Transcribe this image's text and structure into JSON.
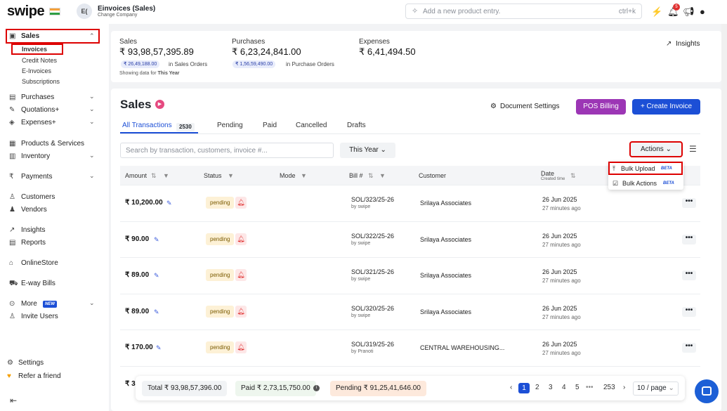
{
  "header": {
    "logo": "swipe",
    "avatar_initials": "E(",
    "company_name": "Einvoices (Sales)",
    "change_company": "Change Company",
    "search_placeholder": "Add a new product entry.",
    "search_shortcut": "ctrl+k",
    "notification_count": "5"
  },
  "sidebar": {
    "sales": "Sales",
    "sales_sub": [
      "Invoices",
      "Credit Notes",
      "E-Invoices",
      "Subscriptions"
    ],
    "purchases": "Purchases",
    "quotations": "Quotations+",
    "expenses": "Expenses+",
    "products": "Products & Services",
    "inventory": "Inventory",
    "payments": "Payments",
    "customers": "Customers",
    "vendors": "Vendors",
    "insights": "Insights",
    "reports": "Reports",
    "onlinestore": "OnlineStore",
    "eway": "E-way Bills",
    "more": "More",
    "more_badge": "NEW",
    "invite": "Invite Users",
    "settings": "Settings",
    "refer": "Refer a friend"
  },
  "stats": {
    "sales_label": "Sales",
    "sales_value": "₹ 93,98,57,395.89",
    "sales_pill": "₹ 26,49,188.00",
    "sales_pill_text": "in Sales Orders",
    "purchases_label": "Purchases",
    "purchases_value": "₹ 6,23,24,841.00",
    "purchases_pill": "₹ 1,56,59,490.00",
    "purchases_pill_text": "in Purchase Orders",
    "expenses_label": "Expenses",
    "expenses_value": "₹ 6,41,494.50",
    "showing_prefix": "Showing data for ",
    "showing_period": "This Year",
    "insights_link": "Insights"
  },
  "main": {
    "title": "Sales",
    "doc_settings": "Document Settings",
    "pos_billing": "POS Billing",
    "create_invoice": "+ Create Invoice",
    "tabs": [
      "All Transactions",
      "Pending",
      "Paid",
      "Cancelled",
      "Drafts"
    ],
    "all_count": "2530",
    "search_placeholder": "Search by transaction, customers, invoice #...",
    "year_filter": "This Year",
    "actions": "Actions",
    "dropdown": {
      "bulk_upload": "Bulk Upload",
      "bulk_actions": "Bulk Actions",
      "beta": "BETA"
    },
    "columns": {
      "amount": "Amount",
      "status": "Status",
      "mode": "Mode",
      "bill": "Bill #",
      "customer": "Customer",
      "date": "Date",
      "date_sub": "Created time"
    },
    "rows": [
      {
        "amount": "₹ 10,200.00",
        "status": "pending",
        "bill": "SOL/323/25-26",
        "by": "by swipe",
        "customer": "Srilaya Associates",
        "date": "26 Jun 2025",
        "ago": "27 minutes ago"
      },
      {
        "amount": "₹ 90.00",
        "status": "pending",
        "bill": "SOL/322/25-26",
        "by": "by swipe",
        "customer": "Srilaya Associates",
        "date": "26 Jun 2025",
        "ago": "27 minutes ago"
      },
      {
        "amount": "₹ 89.00",
        "status": "pending",
        "bill": "SOL/321/25-26",
        "by": "by swipe",
        "customer": "Srilaya Associates",
        "date": "26 Jun 2025",
        "ago": "27 minutes ago"
      },
      {
        "amount": "₹ 89.00",
        "status": "pending",
        "bill": "SOL/320/25-26",
        "by": "by swipe",
        "customer": "Srilaya Associates",
        "date": "26 Jun 2025",
        "ago": "27 minutes ago"
      },
      {
        "amount": "₹ 170.00",
        "status": "pending",
        "bill": "SOL/319/25-26",
        "by": "by Pranoti",
        "customer": "CENTRAL WAREHOUSING...",
        "date": "26 Jun 2025",
        "ago": "27 minutes ago"
      }
    ],
    "partial_row_amount": "₹ 3"
  },
  "footer": {
    "total": "Total  ₹ 93,98,57,396.00",
    "paid": "Paid  ₹ 2,73,15,750.00",
    "pending": "Pending  ₹ 91,25,41,646.00",
    "pages": [
      "1",
      "2",
      "3",
      "4",
      "5",
      "•••",
      "253"
    ],
    "per_page": "10 / page"
  }
}
